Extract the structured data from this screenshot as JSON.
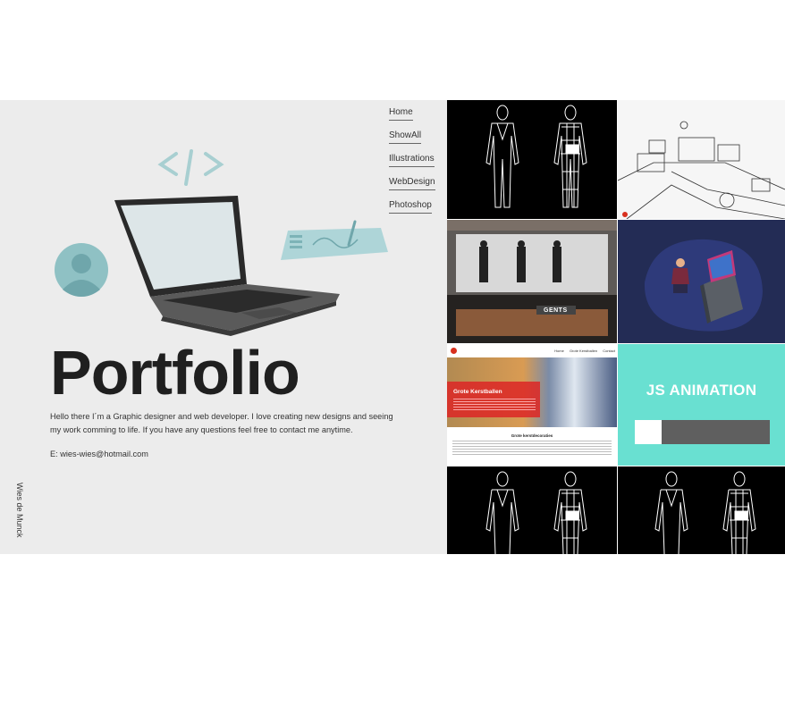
{
  "nav": {
    "items": [
      "Home",
      "ShowAll",
      "Illustrations",
      "WebDesign",
      "Photoshop"
    ]
  },
  "hero": {
    "title": "Portfolio",
    "intro": "Hello there I´m a Graphic designer and web developer. I love creating new designs and seeing my work comming to life. If you have any questions feel free to contact me anytime.",
    "email": "E: wies-wies@hotmail.com",
    "author": "Wies de Munck"
  },
  "portfolio": {
    "gents_sign": "GENTS",
    "website": {
      "links": [
        "Home",
        "Grote Kerstballen",
        "Contact"
      ],
      "hero_title": "Grote Kerstballen",
      "section_title": "Grote kerstdecoraties"
    },
    "js_animation": {
      "label": "JS ANIMATION",
      "progress_percent": 20
    }
  },
  "colors": {
    "left_bg": "#ececec",
    "accent_teal": "#69e0d1",
    "illustration_blue": "#8fc1c4",
    "dark_navy": "#232c55"
  }
}
